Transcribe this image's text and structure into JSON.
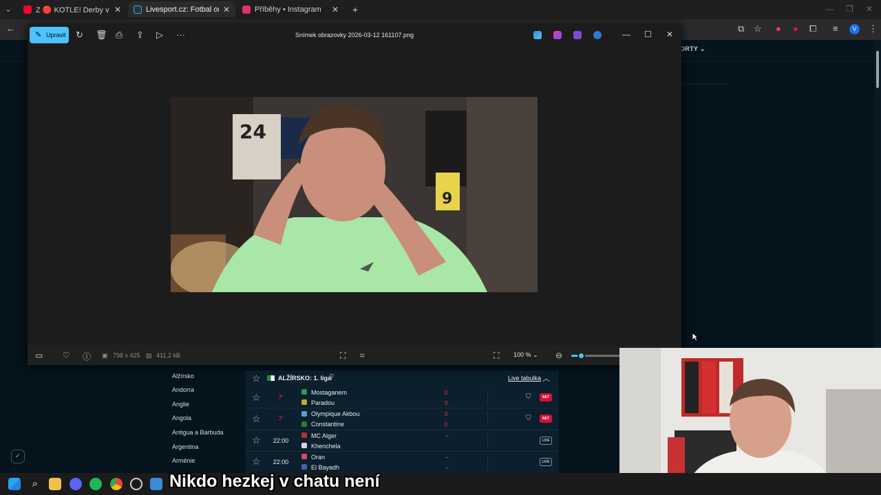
{
  "browser": {
    "tabs": [
      {
        "title": "Z 🔴 KOTLE! Derby v Miláně! Vr",
        "favicon_color": "#ff0033"
      },
      {
        "title": "Livesport.cz: Fotbal online, fotb",
        "favicon_color": "#1b3a4b"
      },
      {
        "title": "Příběhy • Instagram",
        "favicon_color": "#e1306c"
      }
    ],
    "new_tab_label": "+",
    "profile_initial": "V"
  },
  "livesport": {
    "nav_sporty": "ORTY",
    "countries": [
      "Alžírsko",
      "Andorra",
      "Anglie",
      "Angola",
      "Antigua a Barbuda",
      "Argentina",
      "Arménie"
    ],
    "league": {
      "name": "ALŽÍRSKO: 1. liga",
      "live_table_label": "Live tabulka"
    },
    "matches": [
      {
        "time": "7'",
        "live": true,
        "home": "Mostaganem",
        "away": "Paradou",
        "home_score": "0",
        "away_score": "0",
        "action": "BET"
      },
      {
        "time": "7'",
        "live": true,
        "home": "Olympique Akbou",
        "away": "Constantine",
        "home_score": "0",
        "away_score": "0",
        "action": "BET"
      },
      {
        "time": "22:00",
        "live": false,
        "home": "MC Alger",
        "away": "Khenchela",
        "home_score": "-",
        "away_score": "",
        "action": "LIVE"
      },
      {
        "time": "22:00",
        "live": false,
        "home": "Oran",
        "away": "El Bayadh",
        "home_score": "-",
        "away_score": "-",
        "action": "LIVE"
      }
    ]
  },
  "viewer": {
    "edit_label": "Upravit",
    "filename": "Snímek obrazovky 2026-03-12 161107.png",
    "dimensions": "798 x 425",
    "filesize": "411,2 kB",
    "zoom_label": "100 %",
    "zoom_level": 0.15
  },
  "stream": {
    "subtitle": "Nikdo hezkej v chatu není"
  },
  "colors": {
    "accent": "#4cc2ff",
    "live_red": "#ff2b4b",
    "bet_red": "#d5103a"
  }
}
